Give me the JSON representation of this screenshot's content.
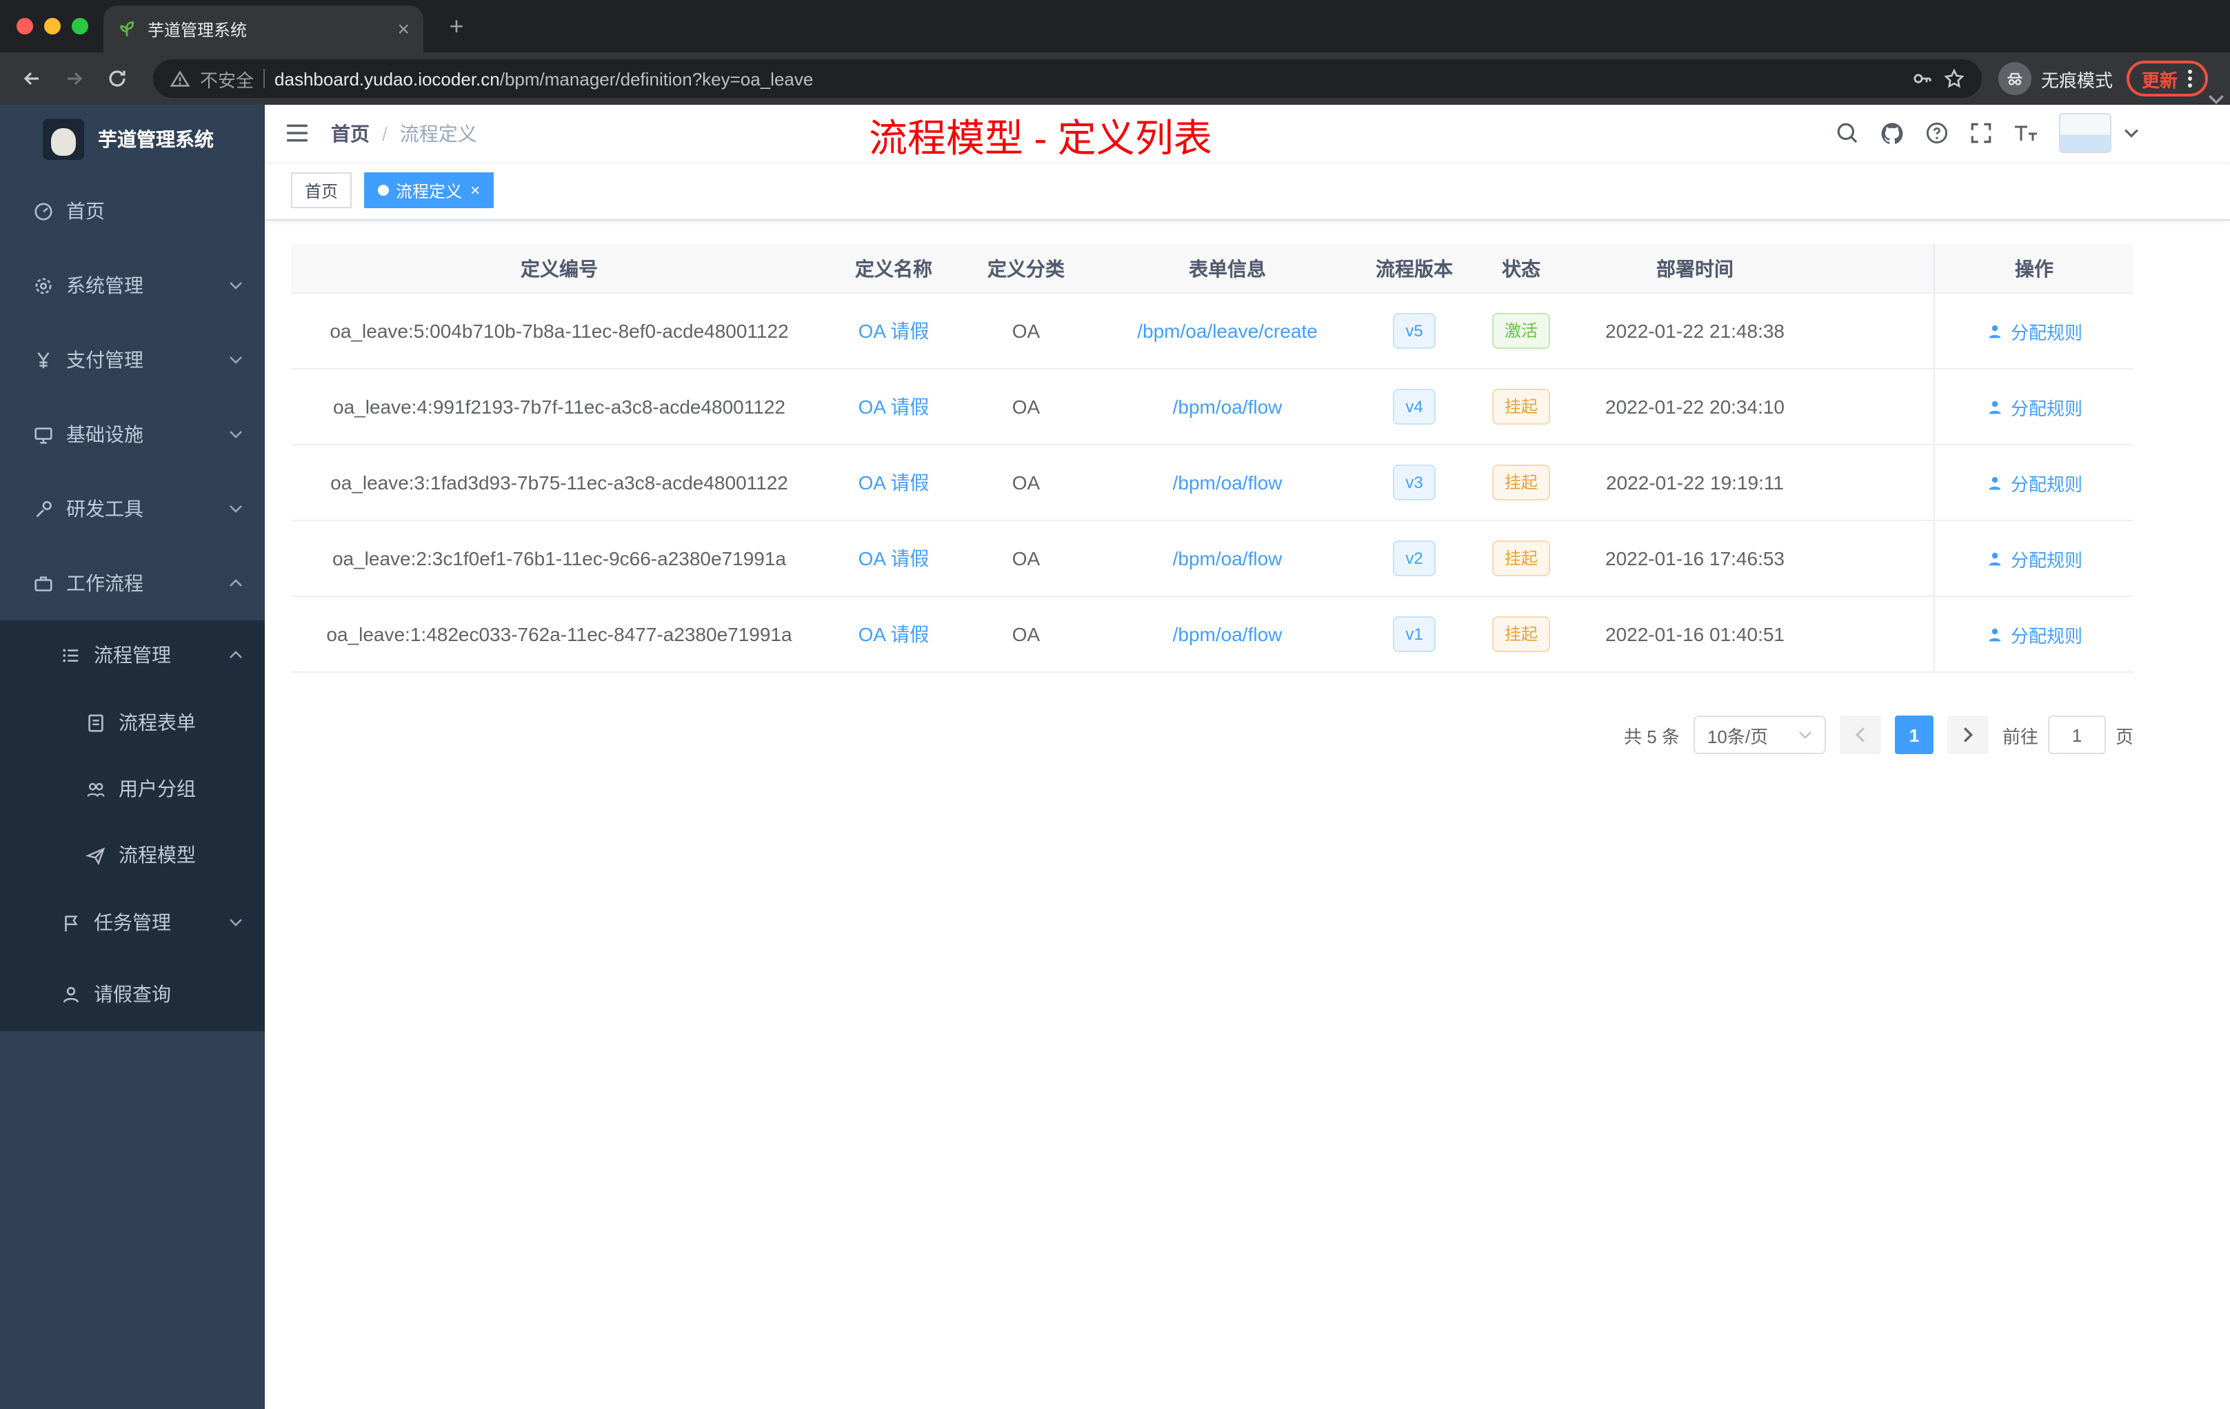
{
  "browser": {
    "tab": {
      "title": "芋道管理系统",
      "close": "×",
      "new_tab": "+"
    },
    "toolbar": {
      "security_label": "不安全",
      "url_domain": "dashboard.yudao.iocoder.cn",
      "url_path": "/bpm/manager/definition?key=oa_leave",
      "incognito_label": "无痕模式",
      "update_label": "更新"
    }
  },
  "sidebar": {
    "logo_title": "芋道管理系统",
    "items": [
      {
        "label": "首页"
      },
      {
        "label": "系统管理"
      },
      {
        "label": "支付管理"
      },
      {
        "label": "基础设施"
      },
      {
        "label": "研发工具"
      },
      {
        "label": "工作流程"
      },
      {
        "label": "流程管理"
      },
      {
        "label": "流程表单"
      },
      {
        "label": "用户分组"
      },
      {
        "label": "流程模型"
      },
      {
        "label": "任务管理"
      },
      {
        "label": "请假查询"
      }
    ]
  },
  "header": {
    "breadcrumb_home": "首页",
    "breadcrumb_separator": "/",
    "breadcrumb_current": "流程定义",
    "annotation": "流程模型 - 定义列表"
  },
  "tags": {
    "home": "首页",
    "active": "流程定义",
    "close": "×"
  },
  "table": {
    "columns": {
      "id": "定义编号",
      "name": "定义名称",
      "category": "定义分类",
      "form": "表单信息",
      "version": "流程版本",
      "status": "状态",
      "deploy_time": "部署时间",
      "action": "操作"
    },
    "rows": [
      {
        "id": "oa_leave:5:004b710b-7b8a-11ec-8ef0-acde48001122",
        "name": "OA 请假",
        "category": "OA",
        "form": "/bpm/oa/leave/create",
        "version": "v5",
        "status": "激活",
        "deploy_time": "2022-01-22 21:48:38",
        "action": "分配规则"
      },
      {
        "id": "oa_leave:4:991f2193-7b7f-11ec-a3c8-acde48001122",
        "name": "OA 请假",
        "category": "OA",
        "form": "/bpm/oa/flow",
        "version": "v4",
        "status": "挂起",
        "deploy_time": "2022-01-22 20:34:10",
        "action": "分配规则"
      },
      {
        "id": "oa_leave:3:1fad3d93-7b75-11ec-a3c8-acde48001122",
        "name": "OA 请假",
        "category": "OA",
        "form": "/bpm/oa/flow",
        "version": "v3",
        "status": "挂起",
        "deploy_time": "2022-01-22 19:19:11",
        "action": "分配规则"
      },
      {
        "id": "oa_leave:2:3c1f0ef1-76b1-11ec-9c66-a2380e71991a",
        "name": "OA 请假",
        "category": "OA",
        "form": "/bpm/oa/flow",
        "version": "v2",
        "status": "挂起",
        "deploy_time": "2022-01-16 17:46:53",
        "action": "分配规则"
      },
      {
        "id": "oa_leave:1:482ec033-762a-11ec-8477-a2380e71991a",
        "name": "OA 请假",
        "category": "OA",
        "form": "/bpm/oa/flow",
        "version": "v1",
        "status": "挂起",
        "deploy_time": "2022-01-16 01:40:51",
        "action": "分配规则"
      }
    ]
  },
  "pagination": {
    "total": "共 5 条",
    "page_size": "10条/页",
    "current_page": "1",
    "goto_label": "前往",
    "goto_value": "1",
    "goto_unit": "页"
  },
  "colors": {
    "primary": "#409eff",
    "success": "#67c23a",
    "warning": "#e6a23c",
    "annotation_red": "#f70000",
    "sidebar_bg": "#304156",
    "submenu_bg": "#1f2d3d"
  }
}
